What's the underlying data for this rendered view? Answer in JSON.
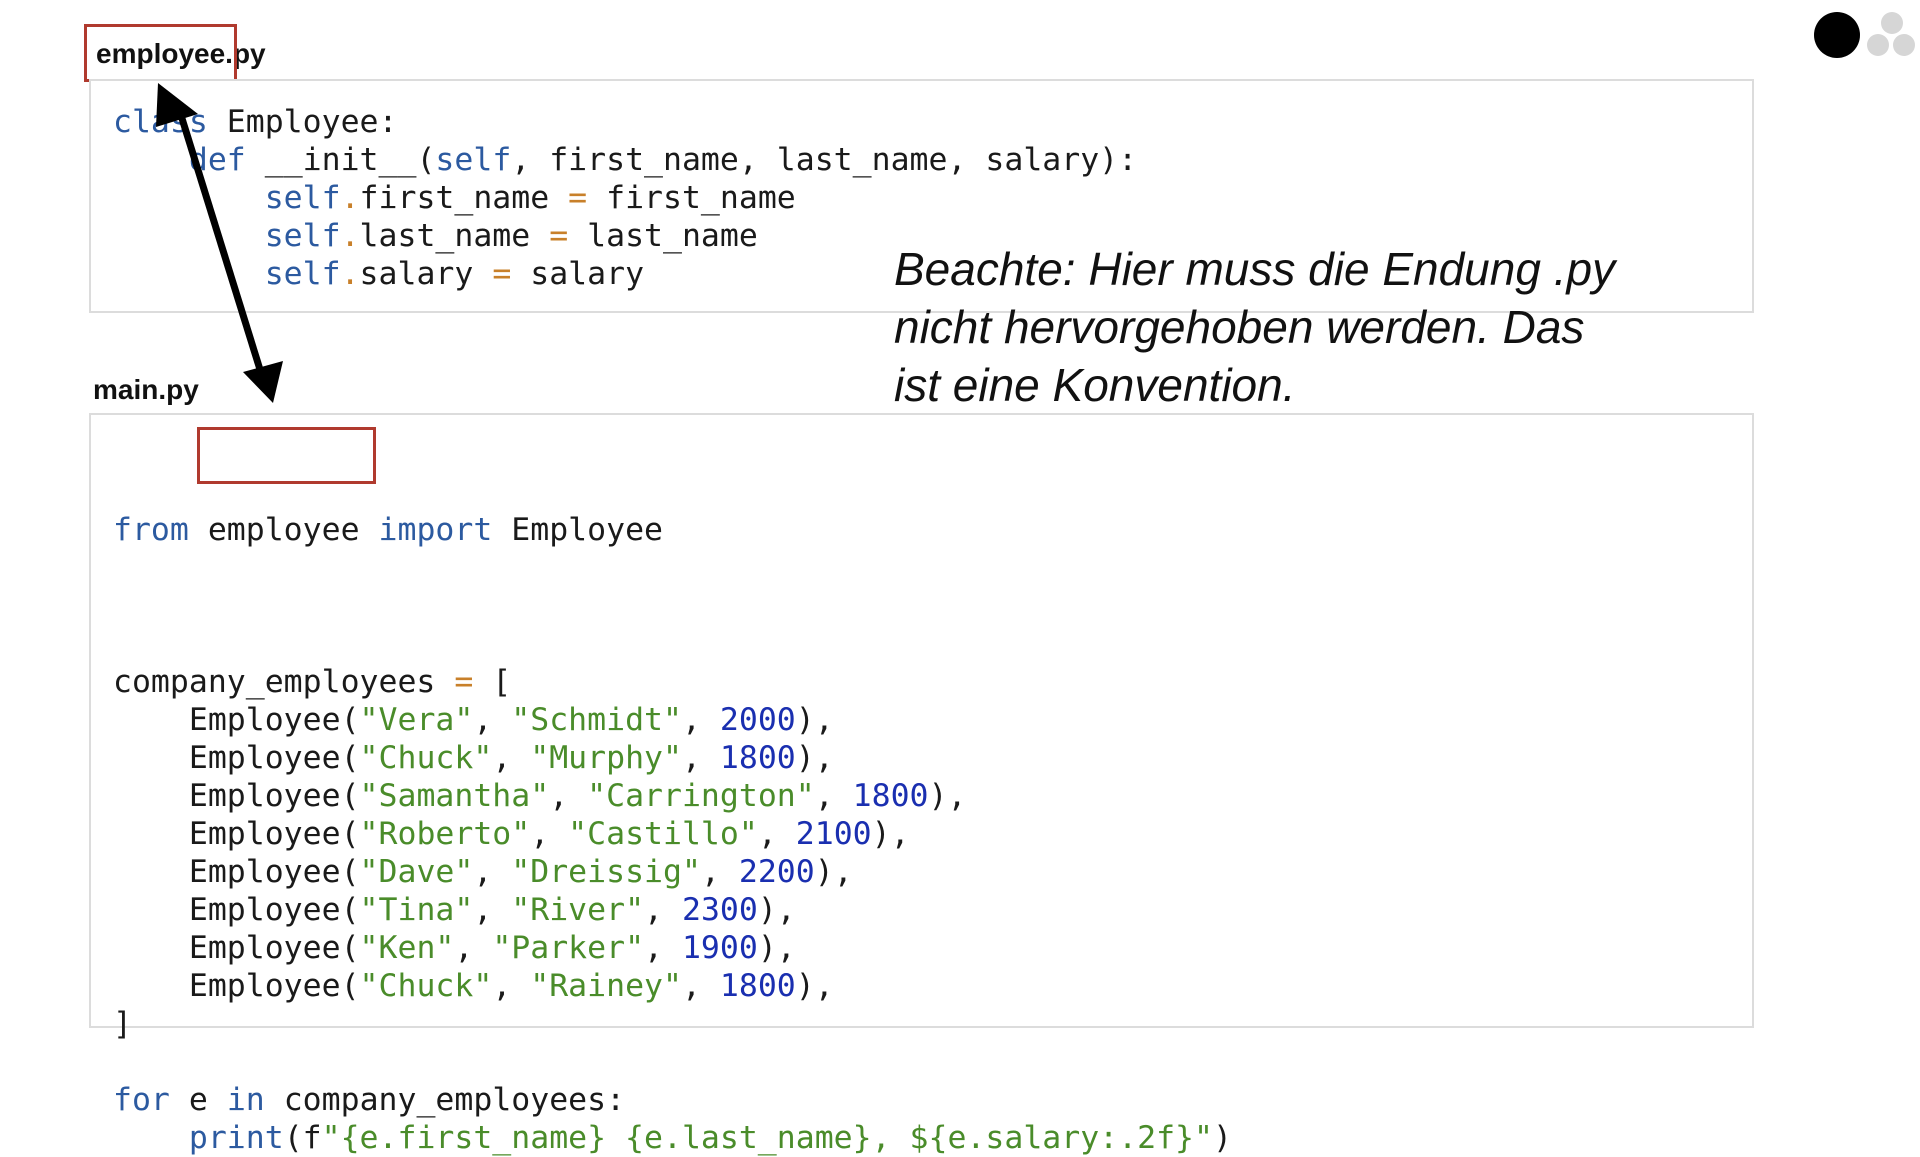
{
  "employee_file": {
    "label": "employee.py",
    "lines": [
      [
        {
          "t": "class",
          "c": "kw"
        },
        {
          "t": " Employee:"
        }
      ],
      [
        {
          "t": "    "
        },
        {
          "t": "def",
          "c": "kw"
        },
        {
          "t": " __init__("
        },
        {
          "t": "self",
          "c": "kw"
        },
        {
          "t": ", first_name, last_name, salary):"
        }
      ],
      [
        {
          "t": "        "
        },
        {
          "t": "self",
          "c": "kw"
        },
        {
          "t": ".",
          "c": "op"
        },
        {
          "t": "first_name "
        },
        {
          "t": "=",
          "c": "op"
        },
        {
          "t": " first_name"
        }
      ],
      [
        {
          "t": "        "
        },
        {
          "t": "self",
          "c": "kw"
        },
        {
          "t": ".",
          "c": "op"
        },
        {
          "t": "last_name "
        },
        {
          "t": "=",
          "c": "op"
        },
        {
          "t": " last_name"
        }
      ],
      [
        {
          "t": "        "
        },
        {
          "t": "self",
          "c": "kw"
        },
        {
          "t": ".",
          "c": "op"
        },
        {
          "t": "salary "
        },
        {
          "t": "=",
          "c": "op"
        },
        {
          "t": " salary"
        }
      ]
    ]
  },
  "main_file": {
    "label": "main.py",
    "import_line": {
      "from_kw": "from",
      "module": "employee",
      "import_kw": "import",
      "name": " Employee"
    },
    "lines": [
      [],
      [
        {
          "t": "company_employees "
        },
        {
          "t": "=",
          "c": "op"
        },
        {
          "t": " ["
        }
      ],
      [
        {
          "t": "    Employee("
        },
        {
          "t": "\"Vera\"",
          "c": "str"
        },
        {
          "t": ", "
        },
        {
          "t": "\"Schmidt\"",
          "c": "str"
        },
        {
          "t": ", "
        },
        {
          "t": "2000",
          "c": "num"
        },
        {
          "t": "),"
        }
      ],
      [
        {
          "t": "    Employee("
        },
        {
          "t": "\"Chuck\"",
          "c": "str"
        },
        {
          "t": ", "
        },
        {
          "t": "\"Murphy\"",
          "c": "str"
        },
        {
          "t": ", "
        },
        {
          "t": "1800",
          "c": "num"
        },
        {
          "t": "),"
        }
      ],
      [
        {
          "t": "    Employee("
        },
        {
          "t": "\"Samantha\"",
          "c": "str"
        },
        {
          "t": ", "
        },
        {
          "t": "\"Carrington\"",
          "c": "str"
        },
        {
          "t": ", "
        },
        {
          "t": "1800",
          "c": "num"
        },
        {
          "t": "),"
        }
      ],
      [
        {
          "t": "    Employee("
        },
        {
          "t": "\"Roberto\"",
          "c": "str"
        },
        {
          "t": ", "
        },
        {
          "t": "\"Castillo\"",
          "c": "str"
        },
        {
          "t": ", "
        },
        {
          "t": "2100",
          "c": "num"
        },
        {
          "t": "),"
        }
      ],
      [
        {
          "t": "    Employee("
        },
        {
          "t": "\"Dave\"",
          "c": "str"
        },
        {
          "t": ", "
        },
        {
          "t": "\"Dreissig\"",
          "c": "str"
        },
        {
          "t": ", "
        },
        {
          "t": "2200",
          "c": "num"
        },
        {
          "t": "),"
        }
      ],
      [
        {
          "t": "    Employee("
        },
        {
          "t": "\"Tina\"",
          "c": "str"
        },
        {
          "t": ", "
        },
        {
          "t": "\"River\"",
          "c": "str"
        },
        {
          "t": ", "
        },
        {
          "t": "2300",
          "c": "num"
        },
        {
          "t": "),"
        }
      ],
      [
        {
          "t": "    Employee("
        },
        {
          "t": "\"Ken\"",
          "c": "str"
        },
        {
          "t": ", "
        },
        {
          "t": "\"Parker\"",
          "c": "str"
        },
        {
          "t": ", "
        },
        {
          "t": "1900",
          "c": "num"
        },
        {
          "t": "),"
        }
      ],
      [
        {
          "t": "    Employee("
        },
        {
          "t": "\"Chuck\"",
          "c": "str"
        },
        {
          "t": ", "
        },
        {
          "t": "\"Rainey\"",
          "c": "str"
        },
        {
          "t": ", "
        },
        {
          "t": "1800",
          "c": "num"
        },
        {
          "t": "),"
        }
      ],
      [
        {
          "t": "]"
        }
      ],
      [],
      [
        {
          "t": "for",
          "c": "kw"
        },
        {
          "t": " e "
        },
        {
          "t": "in",
          "c": "kw"
        },
        {
          "t": " company_employees:"
        }
      ],
      [
        {
          "t": "    "
        },
        {
          "t": "print",
          "c": "kw"
        },
        {
          "t": "(f"
        },
        {
          "t": "\"{e.first_name} {e.last_name}, ${e.salary:.2f}\"",
          "c": "str"
        },
        {
          "t": ")"
        }
      ]
    ]
  },
  "note": "Beachte: Hier muss die Endung .py nicht hervorgehoben werden. Das ist eine Konvention.",
  "colors": {
    "highlight_box": "#b03a2e",
    "arrow": "#000000",
    "dot_active": "#000000",
    "dot_inactive": "#d6d6d6"
  }
}
